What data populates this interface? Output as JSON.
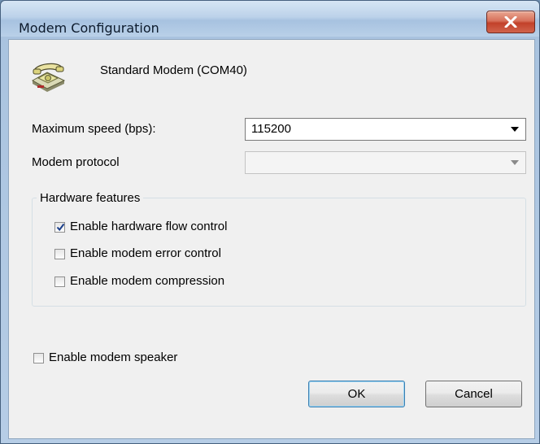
{
  "window": {
    "title": "Modem Configuration",
    "close_icon": "close-icon",
    "accent_color": "#c2412a"
  },
  "device": {
    "icon": "telephone-modem-icon",
    "name": "Standard Modem (COM40)"
  },
  "settings": {
    "max_speed_label": "Maximum speed (bps):",
    "max_speed_value": "115200",
    "protocol_label": "Modem protocol",
    "protocol_value": ""
  },
  "hardware": {
    "group_label": "Hardware features",
    "options": [
      {
        "label": "Enable hardware flow control",
        "checked": true
      },
      {
        "label": "Enable modem error control",
        "checked": false
      },
      {
        "label": "Enable modem compression",
        "checked": false
      }
    ]
  },
  "speaker": {
    "label": "Enable modem speaker",
    "checked": false
  },
  "buttons": {
    "ok_label": "OK",
    "cancel_label": "Cancel"
  }
}
